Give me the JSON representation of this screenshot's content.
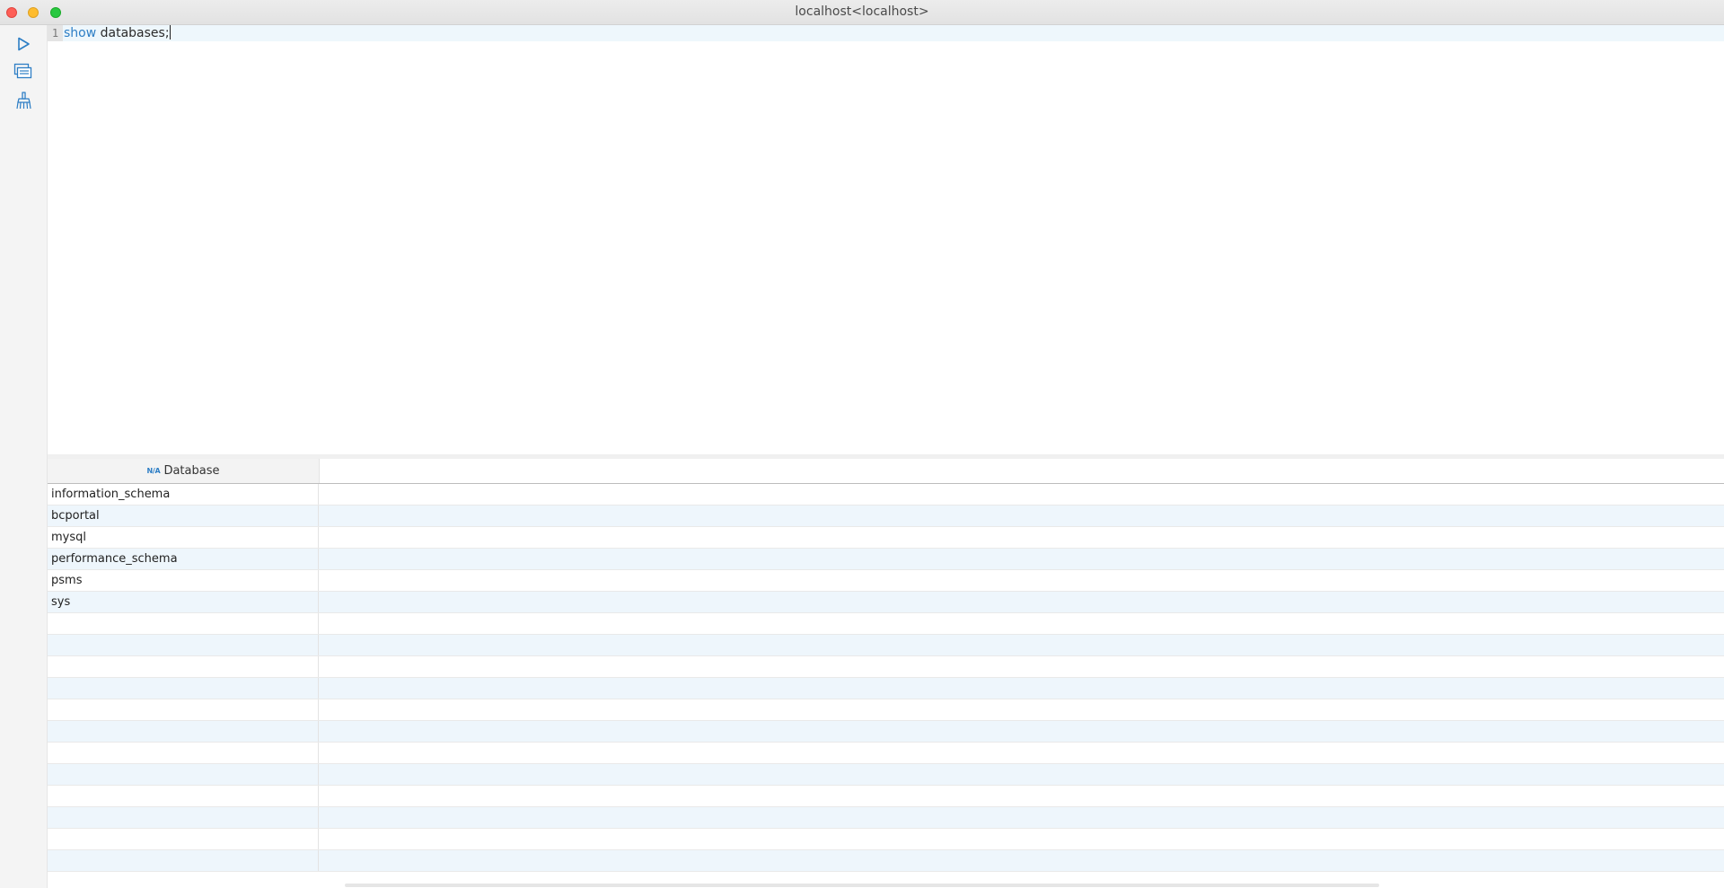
{
  "window": {
    "title": "localhost<localhost>"
  },
  "toolbar": {
    "items": [
      {
        "name": "run-icon",
        "color": "#2d7ec5"
      },
      {
        "name": "query-history-icon",
        "color": "#2d7ec5"
      },
      {
        "name": "clear-brush-icon",
        "color": "#2d7ec5"
      }
    ]
  },
  "editor": {
    "line_number": "1",
    "keyword": "show",
    "identifier": "databases;"
  },
  "grid": {
    "column_type_badge": "N/A",
    "column_header": "Database",
    "rows": [
      "information_schema",
      "bcportal",
      "mysql",
      "performance_schema",
      "psms",
      "sys"
    ],
    "empty_row_count": 12
  },
  "colors": {
    "accent": "#2d7ec5",
    "row_alt": "#eef6fc",
    "close": "#fe5f57",
    "minimize": "#febc2e",
    "maximize": "#28c840"
  }
}
